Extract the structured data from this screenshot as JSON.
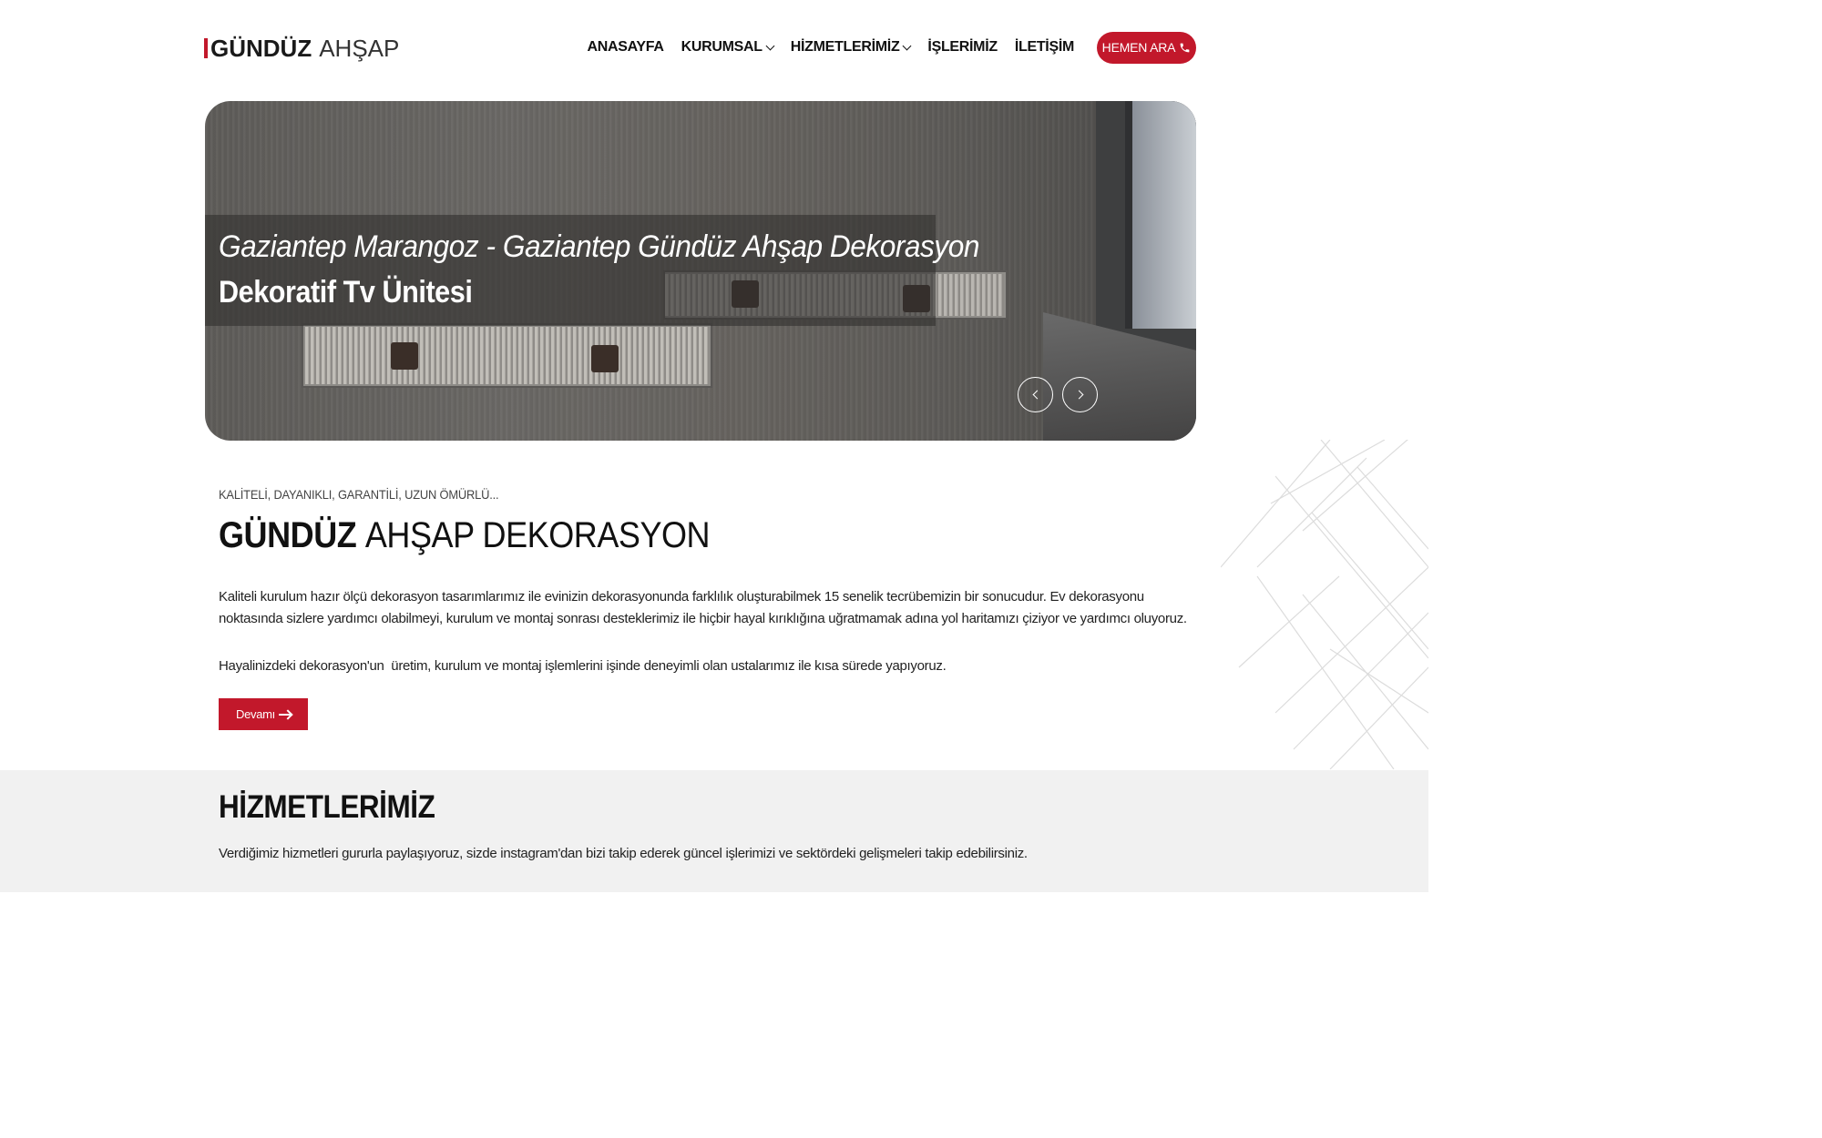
{
  "brand": {
    "name_bold": "GÜNDÜZ",
    "name_light": "AHŞAP",
    "accent": "#c2182b"
  },
  "nav": {
    "items": [
      {
        "label": "ANASAYFA",
        "dropdown": false
      },
      {
        "label": "KURUMSAL",
        "dropdown": true
      },
      {
        "label": "HİZMETLERİMİZ",
        "dropdown": true
      },
      {
        "label": "İŞLERİMİZ",
        "dropdown": false
      },
      {
        "label": "İLETİŞİM",
        "dropdown": false
      }
    ],
    "cta": {
      "label": "HEMEN ARA",
      "icon": "phone-icon"
    }
  },
  "hero": {
    "subtitle": "Gaziantep Marangoz - Gaziantep Gündüz Ahşap Dekorasyon",
    "title": "Dekoratif Tv Ünitesi",
    "prev_icon": "chevron-left-icon",
    "next_icon": "chevron-right-icon"
  },
  "about": {
    "pretitle": "KALİTELİ, DAYANIKLI, GARANTİLİ, UZUN ÖMÜRLÜ...",
    "title_bold": "GÜNDÜZ",
    "title_light": "AHŞAP DEKORASYON",
    "paragraph1": "Kaliteli kurulum hazır ölçü dekorasyon tasarımlarımız ile evinizin dekorasyonunda farklılık oluşturabilmek 15 senelik tecrübemizin bir sonucudur. Ev dekorasyonu noktasında sizlere yardımcı olabilmeyi, kurulum ve montaj sonrası desteklerimiz ile hiçbir hayal kırıklığına uğratmamak adına yol haritamızı çiziyor ve yardımcı oluyoruz.",
    "paragraph2": "Hayalinizdeki dekorasyon'un  üretim, kurulum ve montaj işlemlerini işinde deneyimli olan ustalarımız ile kısa sürede yapıyoruz.",
    "more_label": "Devamı"
  },
  "services": {
    "title": "HİZMETLERİMİZ",
    "description": "Verdiğimiz hizmetleri gururla paylaşıyoruz, sizde instagram'dan bizi takip ederek güncel işlerimizi ve sektördeki gelişmeleri takip edebilirsiniz."
  }
}
